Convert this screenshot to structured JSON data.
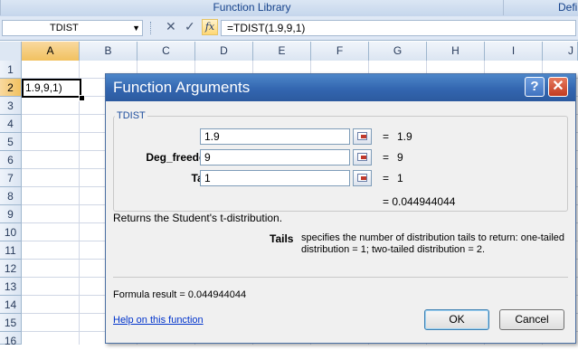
{
  "ribbon": {
    "groups": [
      "Function Library",
      "Defi"
    ]
  },
  "formula_bar": {
    "name_box": "TDIST",
    "icons": [
      "dropdown-arrow-icon",
      "cancel-x-icon",
      "enter-check-icon",
      "insert-function-icon"
    ],
    "fx_label": "fx",
    "formula": "=TDIST(1.9,9,1)"
  },
  "sheet": {
    "columns": [
      "A",
      "B",
      "C",
      "D",
      "E",
      "F",
      "G",
      "H",
      "I",
      "J"
    ],
    "rows": [
      "1",
      "2",
      "3",
      "4",
      "5",
      "6",
      "7",
      "8",
      "9",
      "10",
      "11",
      "12",
      "13",
      "14",
      "15",
      "16"
    ],
    "active_cell_text": "1.9,9,1)"
  },
  "dialog": {
    "title": "Function Arguments",
    "help_glyph": "?",
    "close_glyph": "✕",
    "function_name": "TDIST",
    "args": [
      {
        "label": "X",
        "value": "1.9",
        "eq": "=",
        "result": "1.9"
      },
      {
        "label": "Deg_freedom",
        "value": "9",
        "eq": "=",
        "result": "9"
      },
      {
        "label": "Tails",
        "value": "1",
        "eq": "=",
        "result": "1"
      }
    ],
    "overall_result": "= 0.044944044",
    "description": "Returns the Student's t-distribution.",
    "arg_help_label": "Tails",
    "arg_help_text": "specifies the number of distribution tails to return: one-tailed distribution = 1; two-tailed distribution = 2.",
    "formula_result": "Formula result =  0.044944044",
    "help_link": "Help on this function",
    "ok_label": "OK",
    "cancel_label": "Cancel"
  }
}
